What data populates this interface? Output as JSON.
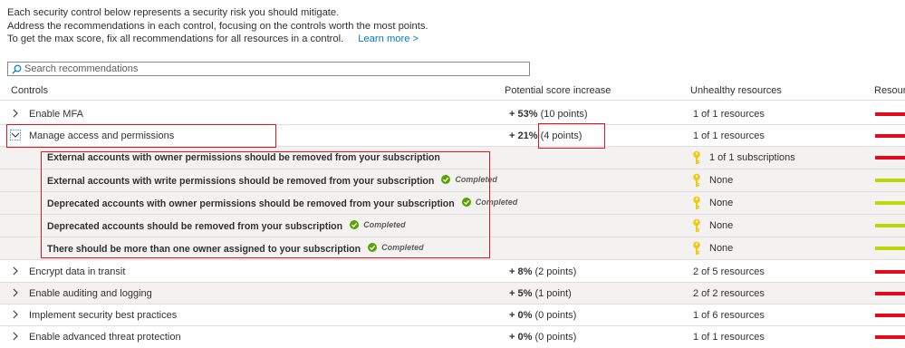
{
  "intro": {
    "line1": "Each security control below represents a security risk you should mitigate.",
    "line2": "Address the recommendations in each control, focusing on the controls worth the most points.",
    "line3": "To get the max score, fix all recommendations for all resources in a control.",
    "learn_more": "Learn more >"
  },
  "search": {
    "placeholder": "Search recommendations"
  },
  "headers": {
    "controls": "Controls",
    "potential": "Potential score increase",
    "unhealthy": "Unhealthy resources",
    "resource": "Resour"
  },
  "colors": {
    "red": "#e00b1c",
    "green": "#bad80a",
    "highlight": "#e81123",
    "link": "#0078d4",
    "key": "#f2c811",
    "check": "#57a300"
  },
  "controls": [
    {
      "name": "Enable MFA",
      "score": "+ 53%",
      "points": "(10 points)",
      "unhealthy": "1 of 1 resources",
      "bar": "red",
      "expanded": false
    },
    {
      "name": "Manage access and permissions",
      "score": "+ 21%",
      "points": "(4 points)",
      "unhealthy": "1 of 1 resources",
      "bar": "red",
      "expanded": true
    },
    {
      "name": "Encrypt data in transit",
      "score": "+ 8%",
      "points": "(2 points)",
      "unhealthy": "2 of 5 resources",
      "bar": "red",
      "expanded": false
    },
    {
      "name": "Enable auditing and logging",
      "score": "+ 5%",
      "points": "(1 point)",
      "unhealthy": "2 of 2 resources",
      "bar": "red",
      "expanded": false
    },
    {
      "name": "Implement security best practices",
      "score": "+ 0%",
      "points": "(0 points)",
      "unhealthy": "1 of 6 resources",
      "bar": "red",
      "expanded": false
    },
    {
      "name": "Enable advanced threat protection",
      "score": "+ 0%",
      "points": "(0 points)",
      "unhealthy": "1 of 1 resources",
      "bar": "red",
      "expanded": false
    }
  ],
  "recommendations": [
    {
      "name": "External accounts with owner permissions should be removed from your subscription",
      "status": "",
      "unhealthy": "1 of 1 subscriptions",
      "bar": "red"
    },
    {
      "name": "External accounts with write permissions should be removed from your subscription",
      "status": "Completed",
      "unhealthy": "None",
      "bar": "green"
    },
    {
      "name": "Deprecated accounts with owner permissions should be removed from your subscription",
      "status": "Completed",
      "unhealthy": "None",
      "bar": "green"
    },
    {
      "name": "Deprecated accounts should be removed from your subscription",
      "status": "Completed",
      "unhealthy": "None",
      "bar": "green"
    },
    {
      "name": "There should be more than one owner assigned to your subscription",
      "status": "Completed",
      "unhealthy": "None",
      "bar": "green"
    }
  ]
}
